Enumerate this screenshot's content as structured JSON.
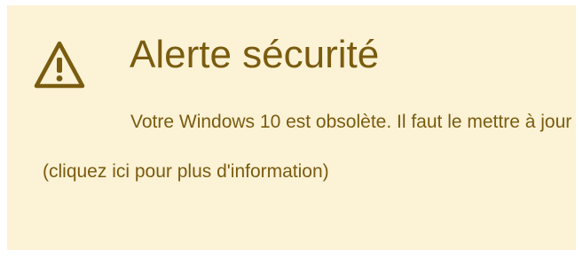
{
  "alert": {
    "icon": "warning-triangle-icon",
    "title": "Alerte sécurité",
    "message": "Votre Windows 10 est obsolète. Il faut le mettre à jour (cliquez ici pour plus d'information)",
    "colors": {
      "background": "#fcf2d6",
      "text": "#7a5c0f"
    }
  }
}
